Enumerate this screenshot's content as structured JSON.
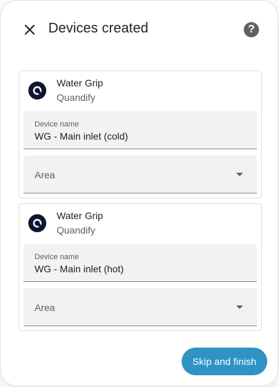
{
  "dialog": {
    "title": "Devices created",
    "close_icon": "close-icon",
    "help_icon": "help-icon"
  },
  "devices": [
    {
      "brand_name": "Water Grip",
      "manufacturer": "Quandify",
      "device_name_label": "Device name",
      "device_name_value": "WG - Main inlet (cold)",
      "area_label": "Area"
    },
    {
      "brand_name": "Water Grip",
      "manufacturer": "Quandify",
      "device_name_label": "Device name",
      "device_name_value": "WG - Main inlet (hot)",
      "area_label": "Area"
    }
  ],
  "actions": {
    "finish_label": "Skip and finish"
  },
  "colors": {
    "accent": "#2f93c6",
    "logo_bg": "#0e1531",
    "field_bg": "#f2f2f2"
  }
}
